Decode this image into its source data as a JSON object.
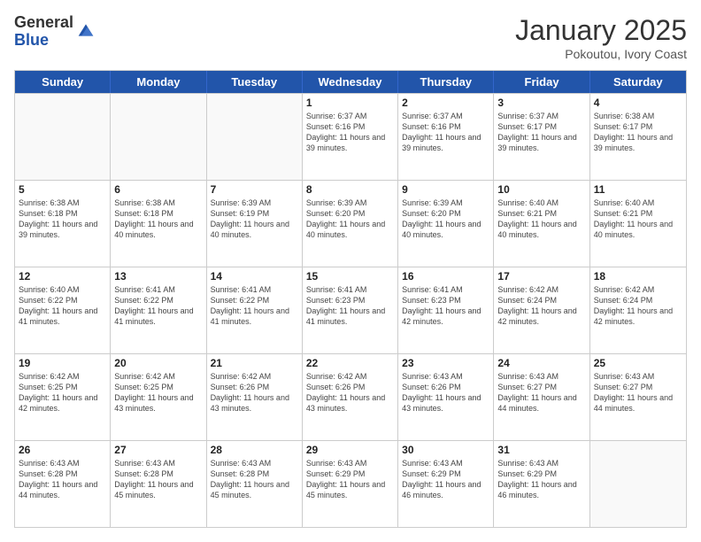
{
  "logo": {
    "general": "General",
    "blue": "Blue"
  },
  "header": {
    "month_year": "January 2025",
    "subtitle": "Pokoutou, Ivory Coast"
  },
  "days_of_week": [
    "Sunday",
    "Monday",
    "Tuesday",
    "Wednesday",
    "Thursday",
    "Friday",
    "Saturday"
  ],
  "weeks": [
    [
      {
        "day": "",
        "info": ""
      },
      {
        "day": "",
        "info": ""
      },
      {
        "day": "",
        "info": ""
      },
      {
        "day": "1",
        "info": "Sunrise: 6:37 AM\nSunset: 6:16 PM\nDaylight: 11 hours and 39 minutes."
      },
      {
        "day": "2",
        "info": "Sunrise: 6:37 AM\nSunset: 6:16 PM\nDaylight: 11 hours and 39 minutes."
      },
      {
        "day": "3",
        "info": "Sunrise: 6:37 AM\nSunset: 6:17 PM\nDaylight: 11 hours and 39 minutes."
      },
      {
        "day": "4",
        "info": "Sunrise: 6:38 AM\nSunset: 6:17 PM\nDaylight: 11 hours and 39 minutes."
      }
    ],
    [
      {
        "day": "5",
        "info": "Sunrise: 6:38 AM\nSunset: 6:18 PM\nDaylight: 11 hours and 39 minutes."
      },
      {
        "day": "6",
        "info": "Sunrise: 6:38 AM\nSunset: 6:18 PM\nDaylight: 11 hours and 40 minutes."
      },
      {
        "day": "7",
        "info": "Sunrise: 6:39 AM\nSunset: 6:19 PM\nDaylight: 11 hours and 40 minutes."
      },
      {
        "day": "8",
        "info": "Sunrise: 6:39 AM\nSunset: 6:20 PM\nDaylight: 11 hours and 40 minutes."
      },
      {
        "day": "9",
        "info": "Sunrise: 6:39 AM\nSunset: 6:20 PM\nDaylight: 11 hours and 40 minutes."
      },
      {
        "day": "10",
        "info": "Sunrise: 6:40 AM\nSunset: 6:21 PM\nDaylight: 11 hours and 40 minutes."
      },
      {
        "day": "11",
        "info": "Sunrise: 6:40 AM\nSunset: 6:21 PM\nDaylight: 11 hours and 40 minutes."
      }
    ],
    [
      {
        "day": "12",
        "info": "Sunrise: 6:40 AM\nSunset: 6:22 PM\nDaylight: 11 hours and 41 minutes."
      },
      {
        "day": "13",
        "info": "Sunrise: 6:41 AM\nSunset: 6:22 PM\nDaylight: 11 hours and 41 minutes."
      },
      {
        "day": "14",
        "info": "Sunrise: 6:41 AM\nSunset: 6:22 PM\nDaylight: 11 hours and 41 minutes."
      },
      {
        "day": "15",
        "info": "Sunrise: 6:41 AM\nSunset: 6:23 PM\nDaylight: 11 hours and 41 minutes."
      },
      {
        "day": "16",
        "info": "Sunrise: 6:41 AM\nSunset: 6:23 PM\nDaylight: 11 hours and 42 minutes."
      },
      {
        "day": "17",
        "info": "Sunrise: 6:42 AM\nSunset: 6:24 PM\nDaylight: 11 hours and 42 minutes."
      },
      {
        "day": "18",
        "info": "Sunrise: 6:42 AM\nSunset: 6:24 PM\nDaylight: 11 hours and 42 minutes."
      }
    ],
    [
      {
        "day": "19",
        "info": "Sunrise: 6:42 AM\nSunset: 6:25 PM\nDaylight: 11 hours and 42 minutes."
      },
      {
        "day": "20",
        "info": "Sunrise: 6:42 AM\nSunset: 6:25 PM\nDaylight: 11 hours and 43 minutes."
      },
      {
        "day": "21",
        "info": "Sunrise: 6:42 AM\nSunset: 6:26 PM\nDaylight: 11 hours and 43 minutes."
      },
      {
        "day": "22",
        "info": "Sunrise: 6:42 AM\nSunset: 6:26 PM\nDaylight: 11 hours and 43 minutes."
      },
      {
        "day": "23",
        "info": "Sunrise: 6:43 AM\nSunset: 6:26 PM\nDaylight: 11 hours and 43 minutes."
      },
      {
        "day": "24",
        "info": "Sunrise: 6:43 AM\nSunset: 6:27 PM\nDaylight: 11 hours and 44 minutes."
      },
      {
        "day": "25",
        "info": "Sunrise: 6:43 AM\nSunset: 6:27 PM\nDaylight: 11 hours and 44 minutes."
      }
    ],
    [
      {
        "day": "26",
        "info": "Sunrise: 6:43 AM\nSunset: 6:28 PM\nDaylight: 11 hours and 44 minutes."
      },
      {
        "day": "27",
        "info": "Sunrise: 6:43 AM\nSunset: 6:28 PM\nDaylight: 11 hours and 45 minutes."
      },
      {
        "day": "28",
        "info": "Sunrise: 6:43 AM\nSunset: 6:28 PM\nDaylight: 11 hours and 45 minutes."
      },
      {
        "day": "29",
        "info": "Sunrise: 6:43 AM\nSunset: 6:29 PM\nDaylight: 11 hours and 45 minutes."
      },
      {
        "day": "30",
        "info": "Sunrise: 6:43 AM\nSunset: 6:29 PM\nDaylight: 11 hours and 46 minutes."
      },
      {
        "day": "31",
        "info": "Sunrise: 6:43 AM\nSunset: 6:29 PM\nDaylight: 11 hours and 46 minutes."
      },
      {
        "day": "",
        "info": ""
      }
    ]
  ]
}
